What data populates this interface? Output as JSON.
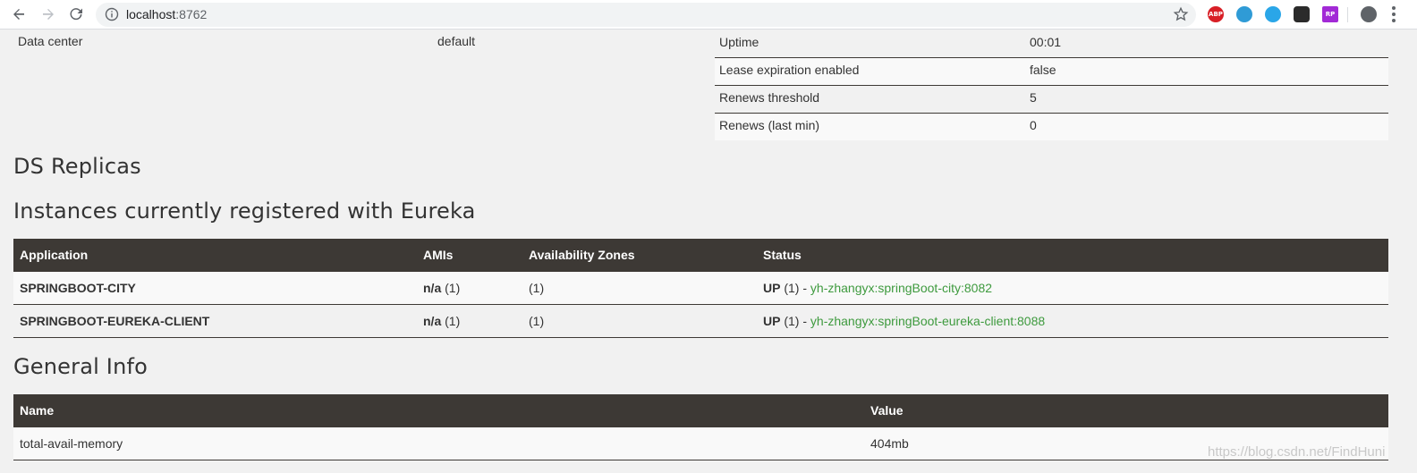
{
  "browser": {
    "url_host": "localhost",
    "url_port": ":8762"
  },
  "extensions": {
    "abp": "ABP",
    "rp": "RP"
  },
  "system_status": {
    "left": {
      "label": "Data center",
      "value": "default"
    },
    "right": [
      {
        "label": "Uptime",
        "value": "00:01"
      },
      {
        "label": "Lease expiration enabled",
        "value": "false"
      },
      {
        "label": "Renews threshold",
        "value": "5"
      },
      {
        "label": "Renews (last min)",
        "value": "0"
      }
    ]
  },
  "ds_replicas": {
    "title": "DS Replicas"
  },
  "instances": {
    "title": "Instances currently registered with Eureka",
    "headers": [
      "Application",
      "AMIs",
      "Availability Zones",
      "Status"
    ],
    "rows": [
      {
        "application": "SPRINGBOOT-CITY",
        "amis_bold": "n/a",
        "amis_count": "(1)",
        "zones": "(1)",
        "status_bold": "UP",
        "status_count": "(1) - ",
        "instance_link": "yh-zhangyx:springBoot-city:8082"
      },
      {
        "application": "SPRINGBOOT-EUREKA-CLIENT",
        "amis_bold": "n/a",
        "amis_count": "(1)",
        "zones": "(1)",
        "status_bold": "UP",
        "status_count": "(1) - ",
        "instance_link": "yh-zhangyx:springBoot-eureka-client:8088"
      }
    ]
  },
  "general_info": {
    "title": "General Info",
    "headers": [
      "Name",
      "Value"
    ],
    "rows": [
      {
        "name": "total-avail-memory",
        "value": "404mb"
      }
    ]
  },
  "watermark": "https://blog.csdn.net/FindHuni"
}
